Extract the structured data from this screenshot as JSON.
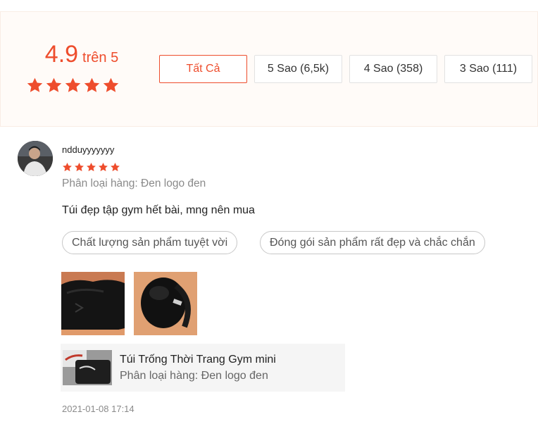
{
  "rating_summary": {
    "score": "4.9",
    "out_of": "trên 5",
    "stars": 5,
    "filters": [
      "Tất Cả",
      "5 Sao (6,5k)",
      "4 Sao (358)",
      "3 Sao (111)"
    ],
    "active_filter": "Tất Cả"
  },
  "review": {
    "username": "ndduyyyyyyy",
    "stars": 5,
    "variation": "Phân loại hàng: Đen logo đen",
    "comment": "Túi đẹp tập gym hết bài, mng nên mua",
    "tags": [
      "Chất lượng sản phẩm tuyệt vời",
      "Đóng gói sản phẩm rất đẹp và chắc chắn"
    ],
    "photos": [
      "review-photo-1",
      "review-photo-2"
    ],
    "product": {
      "name": "Túi Trống Thời Trang Gym mini",
      "variation": "Phân loại hàng: Đen logo đen"
    },
    "timestamp": "2021-01-08 17:14"
  },
  "colors": {
    "accent": "#ee4d2d",
    "summary_bg": "#fffbf8",
    "muted_text": "#8a8a8a"
  }
}
